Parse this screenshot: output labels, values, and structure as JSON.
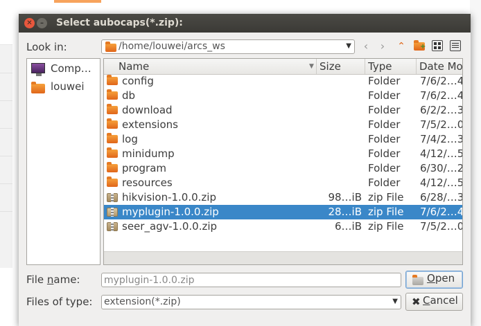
{
  "dialog": {
    "title": "Select aubocaps(*.zip):"
  },
  "look_in": {
    "label": "Look in:",
    "path": "/home/louwei/arcs_ws"
  },
  "toolbar": {
    "icons": [
      "back-icon",
      "forward-icon",
      "parent-dir-icon",
      "new-folder-icon",
      "list-view-icon",
      "detail-view-icon"
    ]
  },
  "places": [
    {
      "label": "Comp…",
      "icon": "computer-icon"
    },
    {
      "label": "louwei",
      "icon": "folder-icon"
    }
  ],
  "columns": [
    "Name",
    "Size",
    "Type",
    "Date Mo"
  ],
  "rows": [
    {
      "name": "config",
      "size": "",
      "type": "Folder",
      "date": "7/6/2…4",
      "kind": "folder",
      "selected": false
    },
    {
      "name": "db",
      "size": "",
      "type": "Folder",
      "date": "7/6/2…4",
      "kind": "folder",
      "selected": false
    },
    {
      "name": "download",
      "size": "",
      "type": "Folder",
      "date": "6/2/2…3",
      "kind": "folder",
      "selected": false
    },
    {
      "name": "extensions",
      "size": "",
      "type": "Folder",
      "date": "7/5/2…0",
      "kind": "folder",
      "selected": false
    },
    {
      "name": "log",
      "size": "",
      "type": "Folder",
      "date": "7/4/2…3",
      "kind": "folder",
      "selected": false
    },
    {
      "name": "minidump",
      "size": "",
      "type": "Folder",
      "date": "4/12/…5",
      "kind": "folder",
      "selected": false
    },
    {
      "name": "program",
      "size": "",
      "type": "Folder",
      "date": "6/30/…2",
      "kind": "folder",
      "selected": false
    },
    {
      "name": "resources",
      "size": "",
      "type": "Folder",
      "date": "4/12/…5",
      "kind": "folder",
      "selected": false
    },
    {
      "name": "hikvision-1.0.0.zip",
      "size": "98…iB",
      "type": "zip File",
      "date": "6/28/…3",
      "kind": "zip",
      "selected": false
    },
    {
      "name": "myplugin-1.0.0.zip",
      "size": "28…iB",
      "type": "zip File",
      "date": "7/6/2…4",
      "kind": "zip",
      "selected": true
    },
    {
      "name": "seer_agv-1.0.0.zip",
      "size": "6…iB",
      "type": "zip File",
      "date": "7/5/2…0",
      "kind": "zip",
      "selected": false
    }
  ],
  "file_name": {
    "label_pre": "File ",
    "label_mn": "n",
    "label_post": "ame:",
    "value": "myplugin-1.0.0.zip"
  },
  "file_type": {
    "label": "Files of type:",
    "value": "extension(*.zip)"
  },
  "buttons": {
    "open_mn": "O",
    "open_rest": "pen",
    "cancel_mn": "C",
    "cancel_rest": "ancel"
  },
  "colors": {
    "selection": "#3a87c8",
    "titlebar": "#3b3a36",
    "close": "#e8573d"
  }
}
